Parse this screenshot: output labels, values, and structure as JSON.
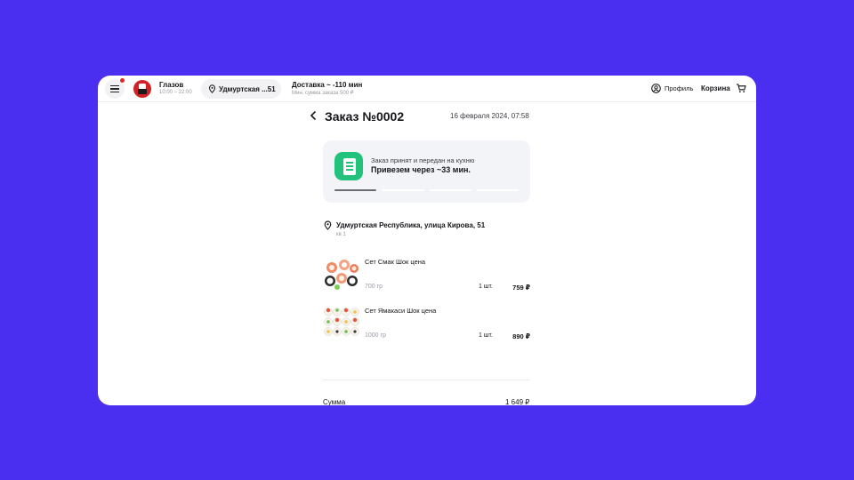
{
  "header": {
    "city": "Глазов",
    "hours": "10:00 – 22:00",
    "address_short": "Удмуртская ...51",
    "delivery": "Доставка ~ -110 мин",
    "min_order": "Мин. сумма заказа 500 ₽",
    "profile": "Профиль",
    "cart": "Корзина"
  },
  "order": {
    "title": "Заказ №0002",
    "date": "16 февраля 2024, 07:58",
    "status_text": "Заказ принят и передан на кухню",
    "eta": "Привезем через ~33 мин.",
    "progress_step": 1,
    "progress_total": 4,
    "address": "Удмуртская Республика, улица Кирова, 51",
    "apartment": "кв 1",
    "items": [
      {
        "name": "Сет Смак Шок цена",
        "weight": "700 гр",
        "qty": "1 шт.",
        "price": "759 ₽"
      },
      {
        "name": "Сет Ямакаси Шок цена",
        "weight": "1000 гр",
        "qty": "1 шт.",
        "price": "890 ₽"
      }
    ],
    "sum_label": "Сумма",
    "sum_value": "1 649 ₽"
  },
  "colors": {
    "background": "#4a2ff0",
    "accent_green": "#22c27d",
    "notification_red": "#e3242b",
    "brand_red": "#d32026"
  },
  "icons": [
    "menu-icon",
    "location-pin-icon",
    "profile-icon",
    "cart-icon",
    "back-arrow-icon"
  ]
}
